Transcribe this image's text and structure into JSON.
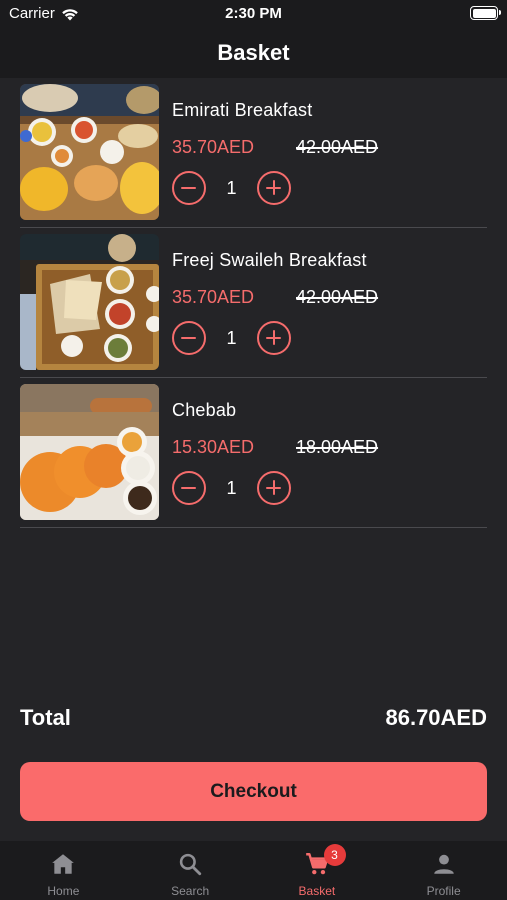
{
  "status_bar": {
    "carrier": "Carrier",
    "time": "2:30 PM"
  },
  "nav": {
    "title": "Basket"
  },
  "items": [
    {
      "name": "Emirati Breakfast",
      "price": "35.70AED",
      "old_price": "42.00AED",
      "quantity": "1"
    },
    {
      "name": "Freej Swaileh Breakfast",
      "price": "35.70AED",
      "old_price": "42.00AED",
      "quantity": "1"
    },
    {
      "name": "Chebab",
      "price": "15.30AED",
      "old_price": "18.00AED",
      "quantity": "1"
    }
  ],
  "total": {
    "label": "Total",
    "value": "86.70AED"
  },
  "checkout_label": "Checkout",
  "tabs": [
    {
      "label": "Home",
      "icon": "home-icon"
    },
    {
      "label": "Search",
      "icon": "search-icon"
    },
    {
      "label": "Basket",
      "icon": "cart-icon",
      "badge": "3",
      "active": true
    },
    {
      "label": "Profile",
      "icon": "person-icon"
    }
  ],
  "colors": {
    "accent": "#f56c6c",
    "button": "#fa6b6b",
    "background": "#242427",
    "bar": "#1b1b1d",
    "badge": "#e63b3b"
  }
}
